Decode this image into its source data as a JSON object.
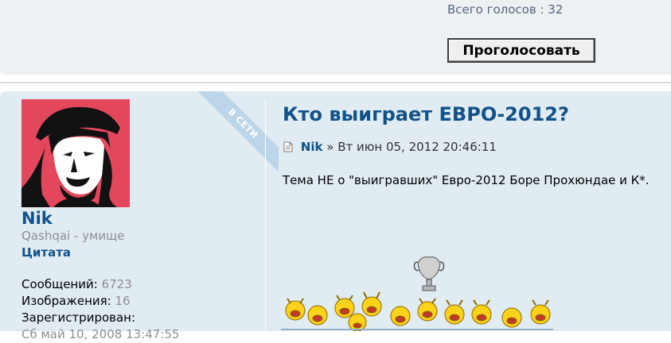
{
  "poll": {
    "total_label": "Всего голосов :",
    "total_value": "32",
    "vote_button": "Проголосовать"
  },
  "post": {
    "online_badge": "В СЕТИ",
    "author": {
      "name": "Nik",
      "rank": "Qashqai - умище",
      "quote_link": "Цитата",
      "messages_label": "Сообщений:",
      "messages_value": "6723",
      "images_label": "Изображения:",
      "images_value": "16",
      "registered_label": "Зарегистрирован:",
      "registered_value": "Сб май 10, 2008 13:47:55"
    },
    "title": "Кто выиграет ЕВРО-2012?",
    "meta": {
      "author": "Nik",
      "separator": "»",
      "date": "Вт июн 05, 2012 20:46:11"
    },
    "body": "Тема НЕ о \"выигравших\" Евро-2012 Боре Прохюндае и К*."
  },
  "colors": {
    "link": "#105289",
    "post_bg": "#e1ebf2",
    "muted": "#8f8f8f"
  }
}
